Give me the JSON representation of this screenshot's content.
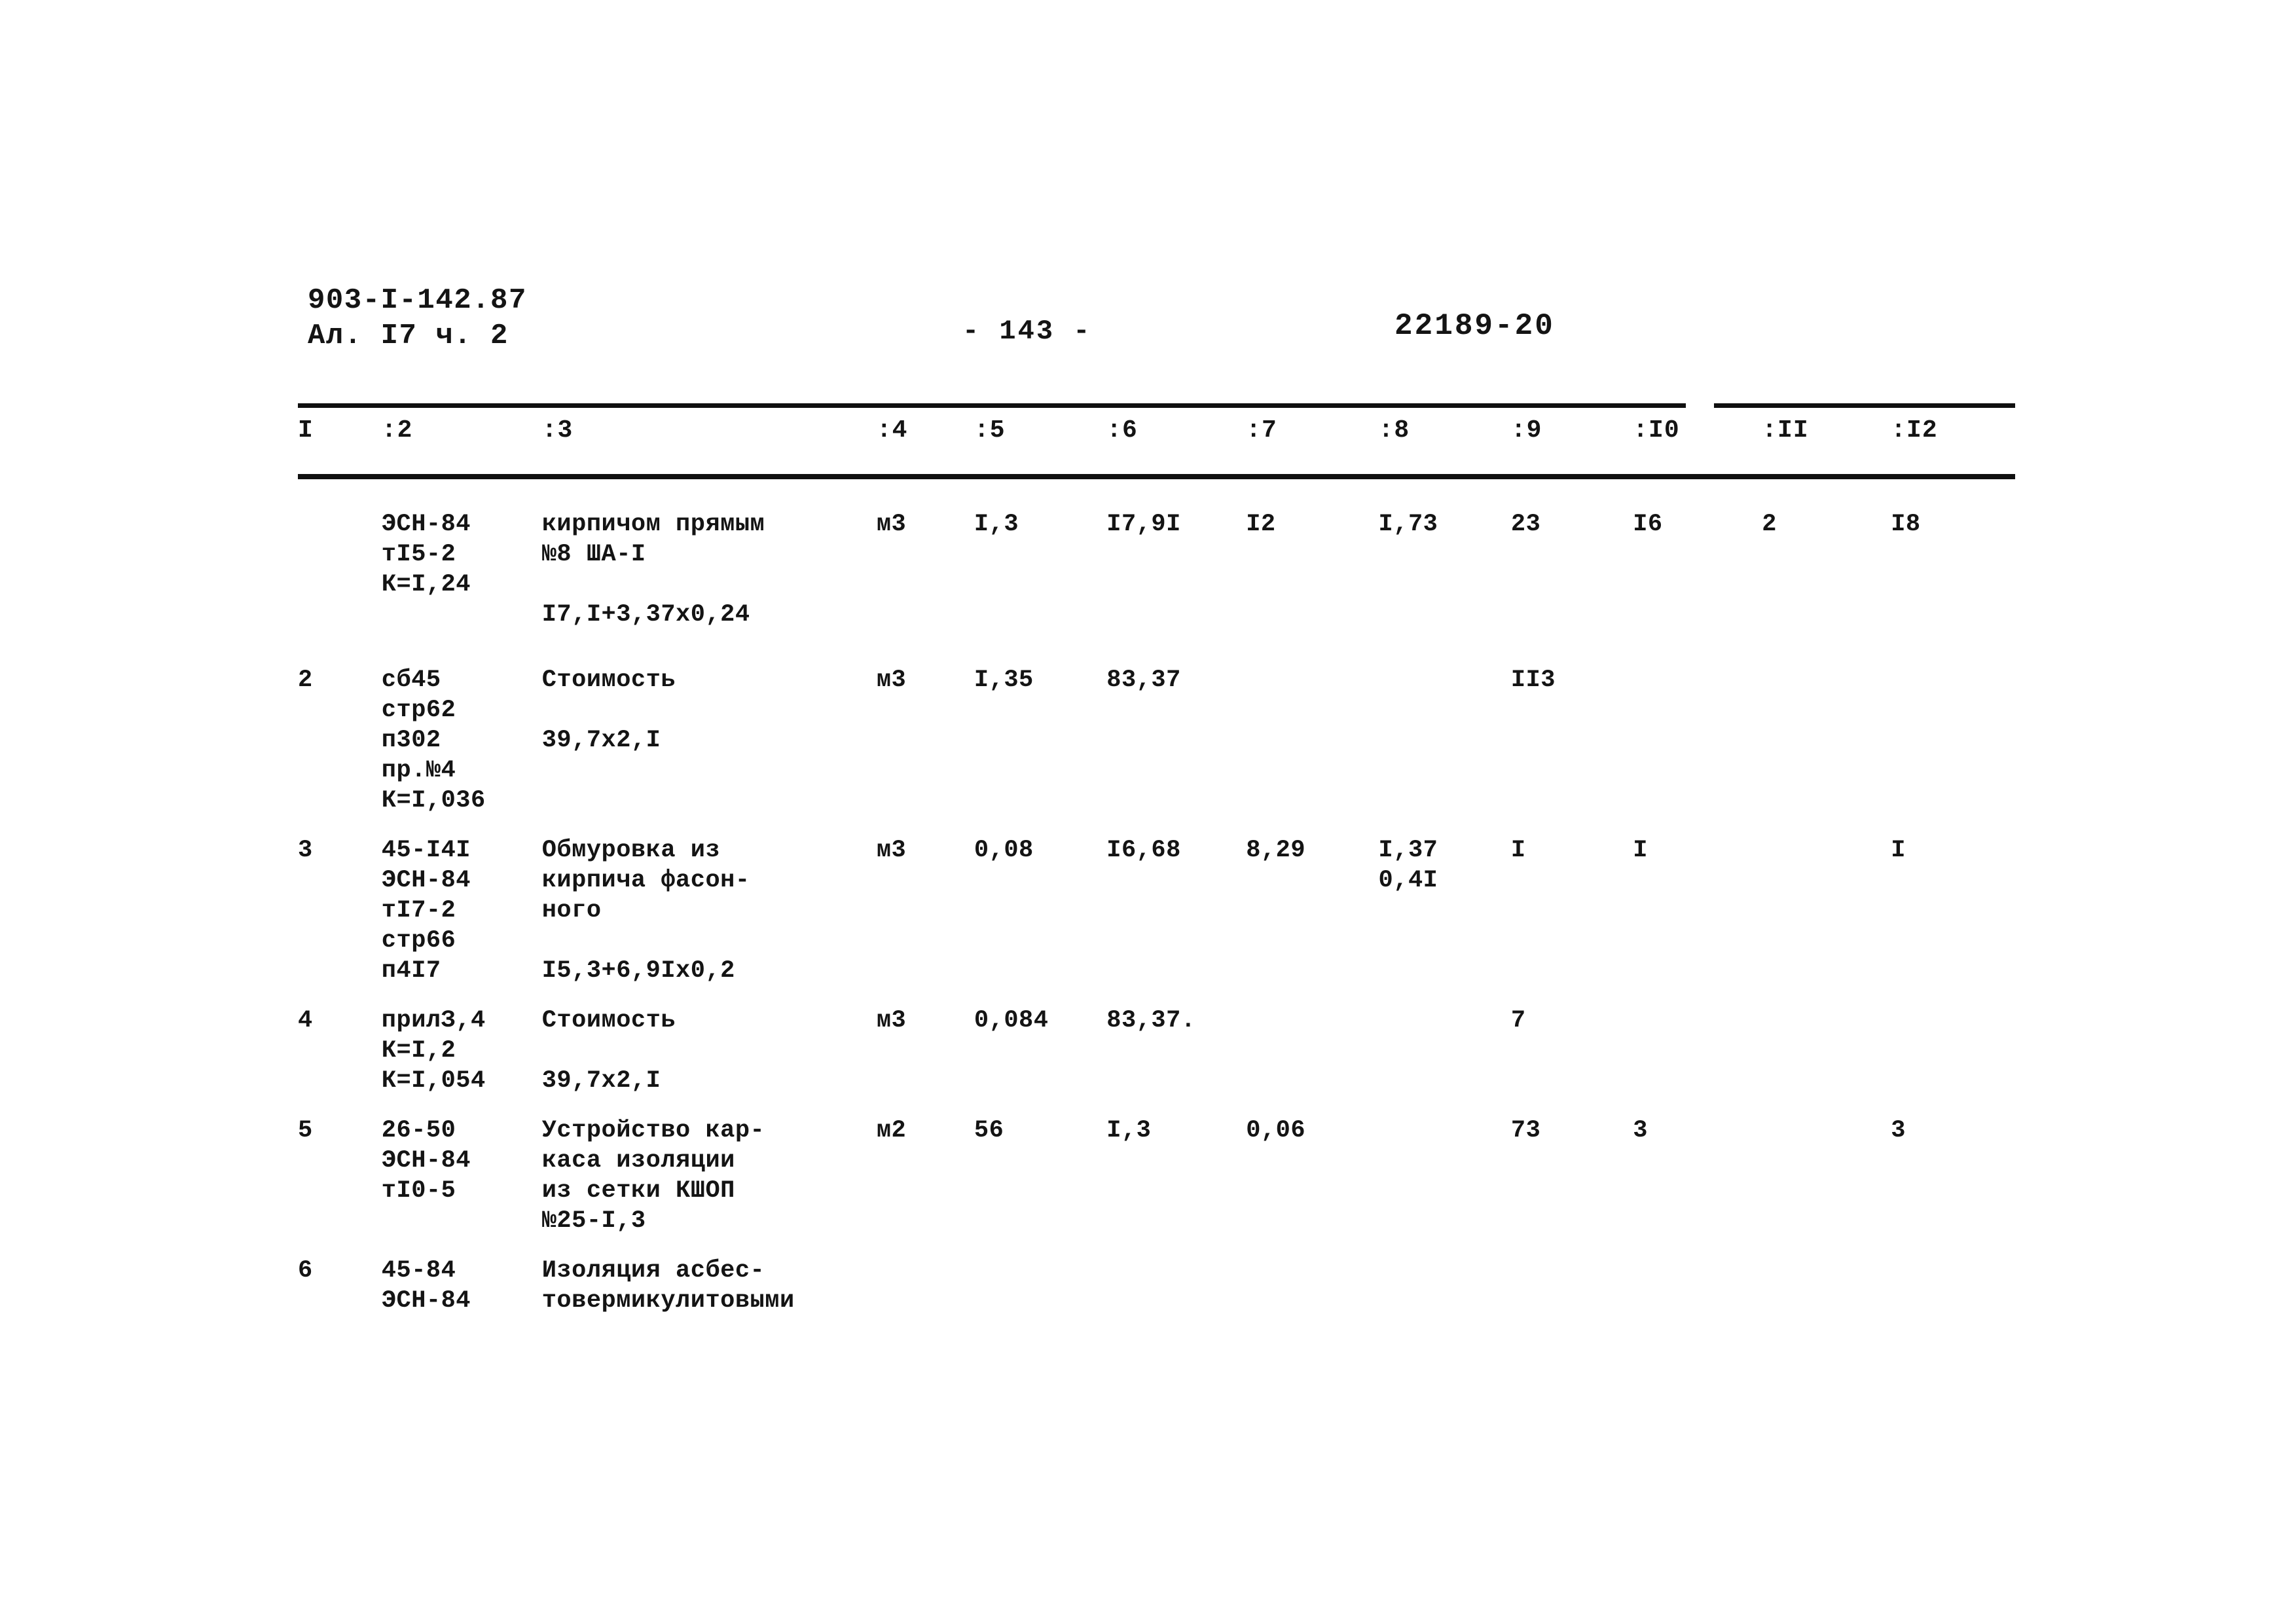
{
  "header": {
    "project_code": "903-I-142.87",
    "album_line": "Ал. I7  ч. 2",
    "page_number": "- 143 -",
    "sheet_code": "22189-20"
  },
  "table": {
    "columns": [
      "I",
      ":2",
      ":3",
      ":4",
      ":5",
      ":6",
      ":7",
      ":8",
      ":9",
      ":I0",
      ":II",
      ":I2"
    ],
    "rows": [
      {
        "num": "",
        "code": "ЭСН-84\nтI5-2\nК=I,24",
        "desc": "кирпичом прямым\n№8 ША-I\n\nI7,I+3,37х0,24",
        "unit": "м3",
        "c5": "I,3",
        "c6": "I7,9I",
        "c7": "I2",
        "c8": "I,73",
        "c9": "23",
        "c10": "I6",
        "c11": "2",
        "c12": "I8"
      },
      {
        "num": "2",
        "code": "сб45\nстр62\nп302\nпр.№4\nК=I,036",
        "desc": "Стоимость\n\n39,7х2,I",
        "unit": "м3",
        "c5": "I,35",
        "c6": "83,37",
        "c7": "",
        "c8": "",
        "c9": "II3",
        "c10": "",
        "c11": "",
        "c12": ""
      },
      {
        "num": "3",
        "code": "45-I4I\nЭСН-84\nтI7-2\nстр66\nп4I7",
        "desc": "Обмуровка из\nкирпича фасон-\nного\n\nI5,3+6,9Iх0,2",
        "unit": "м3",
        "c5": "0,08",
        "c6": "I6,68",
        "c7": "8,29",
        "c8": "I,37\n0,4I",
        "c9": "I",
        "c10": "I",
        "c11": "",
        "c12": "I"
      },
      {
        "num": "4",
        "code": "прилЗ,4\nК=I,2\nК=I,054",
        "desc": "Стоимость\n\n39,7х2,I",
        "unit": "м3",
        "c5": "0,084",
        "c6": "83,37.",
        "c7": "",
        "c8": "",
        "c9": "7",
        "c10": "",
        "c11": "",
        "c12": ""
      },
      {
        "num": "5",
        "code": "26-50\nЭСН-84\nтI0-5",
        "desc": "Устройство кар-\nкаса изоляции\nиз сетки КШОП\n№25-I,3",
        "unit": "м2",
        "c5": "56",
        "c6": "I,3",
        "c7": "0,06",
        "c8": "",
        "c9": "73",
        "c10": "3",
        "c11": "",
        "c12": "3"
      },
      {
        "num": "6",
        "code": "45-84\nЭСН-84",
        "desc": "Изоляция асбес-\nтовермикулитовыми",
        "unit": "",
        "c5": "",
        "c6": "",
        "c7": "",
        "c8": "",
        "c9": "",
        "c10": "",
        "c11": "",
        "c12": ""
      }
    ]
  }
}
